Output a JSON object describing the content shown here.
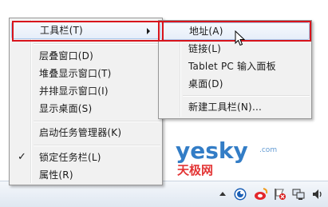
{
  "main_menu": {
    "items": [
      {
        "label": "工具栏(T)"
      },
      {
        "label": "层叠窗口(D)"
      },
      {
        "label": "堆叠显示窗口(T)"
      },
      {
        "label": "并排显示窗口(I)"
      },
      {
        "label": "显示桌面(S)"
      },
      {
        "label": "启动任务管理器(K)"
      },
      {
        "label": "锁定任务栏(L)",
        "checked": true
      },
      {
        "label": "属性(R)"
      }
    ],
    "check_glyph": "✓"
  },
  "sub_menu": {
    "items": [
      {
        "label": "地址(A)"
      },
      {
        "label": "链接(L)"
      },
      {
        "label": "Tablet PC 输入面板"
      },
      {
        "label": "桌面(D)"
      },
      {
        "label": "新建工具栏(N)..."
      }
    ]
  },
  "watermark": {
    "brand": "yesky",
    "suffix": "天极网",
    "domain_tag": ".com",
    "brand_color": "#1e6fc0",
    "accent_color": "#e02020"
  },
  "tray": {
    "icons": [
      "chevron-up-icon",
      "globe-icon",
      "weibo-icon",
      "flag-icon",
      "network-icon",
      "volume-icon"
    ]
  },
  "colors": {
    "annotation": "#d8141c",
    "highlight_border": "#a8c8ec"
  }
}
